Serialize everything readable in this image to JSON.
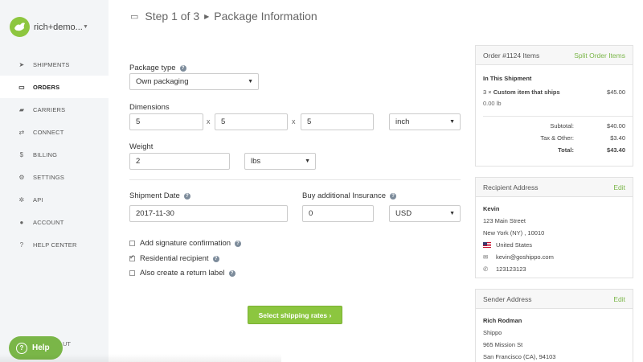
{
  "sidebar": {
    "account_name": "rich+demo...",
    "items": [
      {
        "label": "SHIPMENTS",
        "icon": "paper-plane-icon"
      },
      {
        "label": "ORDERS",
        "icon": "inbox-tray-icon"
      },
      {
        "label": "CARRIERS",
        "icon": "truck-icon"
      },
      {
        "label": "CONNECT",
        "icon": "exchange-arrows-icon"
      },
      {
        "label": "BILLING",
        "icon": "dollar-icon"
      },
      {
        "label": "SETTINGS",
        "icon": "gear-icon"
      },
      {
        "label": "API",
        "icon": "cogs-icon"
      },
      {
        "label": "ACCOUNT",
        "icon": "user-icon"
      },
      {
        "label": "HELP CENTER",
        "icon": "question-circle-icon"
      }
    ],
    "active": "ORDERS",
    "help_button": "Help",
    "logout_partial": "UT"
  },
  "header": {
    "step": "Step 1 of 3",
    "title": "Package Information"
  },
  "form": {
    "package_type_label": "Package type",
    "package_type_value": "Own packaging",
    "dimensions_label": "Dimensions",
    "dim_length": "5",
    "dim_width": "5",
    "dim_height": "5",
    "dim_times": "x",
    "dim_unit": "inch",
    "weight_label": "Weight",
    "weight_value": "2",
    "weight_unit": "lbs",
    "shipment_date_label": "Shipment Date",
    "shipment_date_value": "2017-11-30",
    "insurance_label": "Buy additional Insurance",
    "insurance_value": "0",
    "insurance_currency": "USD",
    "checkboxes": [
      {
        "label": "Add signature confirmation",
        "checked": false
      },
      {
        "label": "Residential recipient",
        "checked": true
      },
      {
        "label": "Also create a return label",
        "checked": false
      }
    ],
    "submit_label": "Select shipping rates ›"
  },
  "order_panel": {
    "title": "Order #1124 Items",
    "link": "Split Order Items",
    "section": "In This Shipment",
    "item_qty": "3 ×",
    "item_name": "Custom item that ships",
    "item_price": "$45.00",
    "item_weight": "0.00 lb",
    "subtotal_label": "Subtotal:",
    "subtotal_value": "$40.00",
    "tax_label": "Tax & Other:",
    "tax_value": "$3.40",
    "total_label": "Total:",
    "total_value": "$43.40"
  },
  "recipient_panel": {
    "title": "Recipient Address",
    "link": "Edit",
    "name": "Kevin",
    "street": "123 Main Street",
    "city": "New York (NY) , 10010",
    "country": "United States",
    "email": "kevin@goshippo.com",
    "phone": "123123123"
  },
  "sender_panel": {
    "title": "Sender Address",
    "link": "Edit",
    "name": "Rich Rodman",
    "company": "Shippo",
    "street": "965 Mission St",
    "city": "San Francisco (CA), 94103"
  },
  "colors": {
    "accent": "#8cc63f",
    "sidebar_bg": "#f3f5f7",
    "link": "#7ab648"
  }
}
